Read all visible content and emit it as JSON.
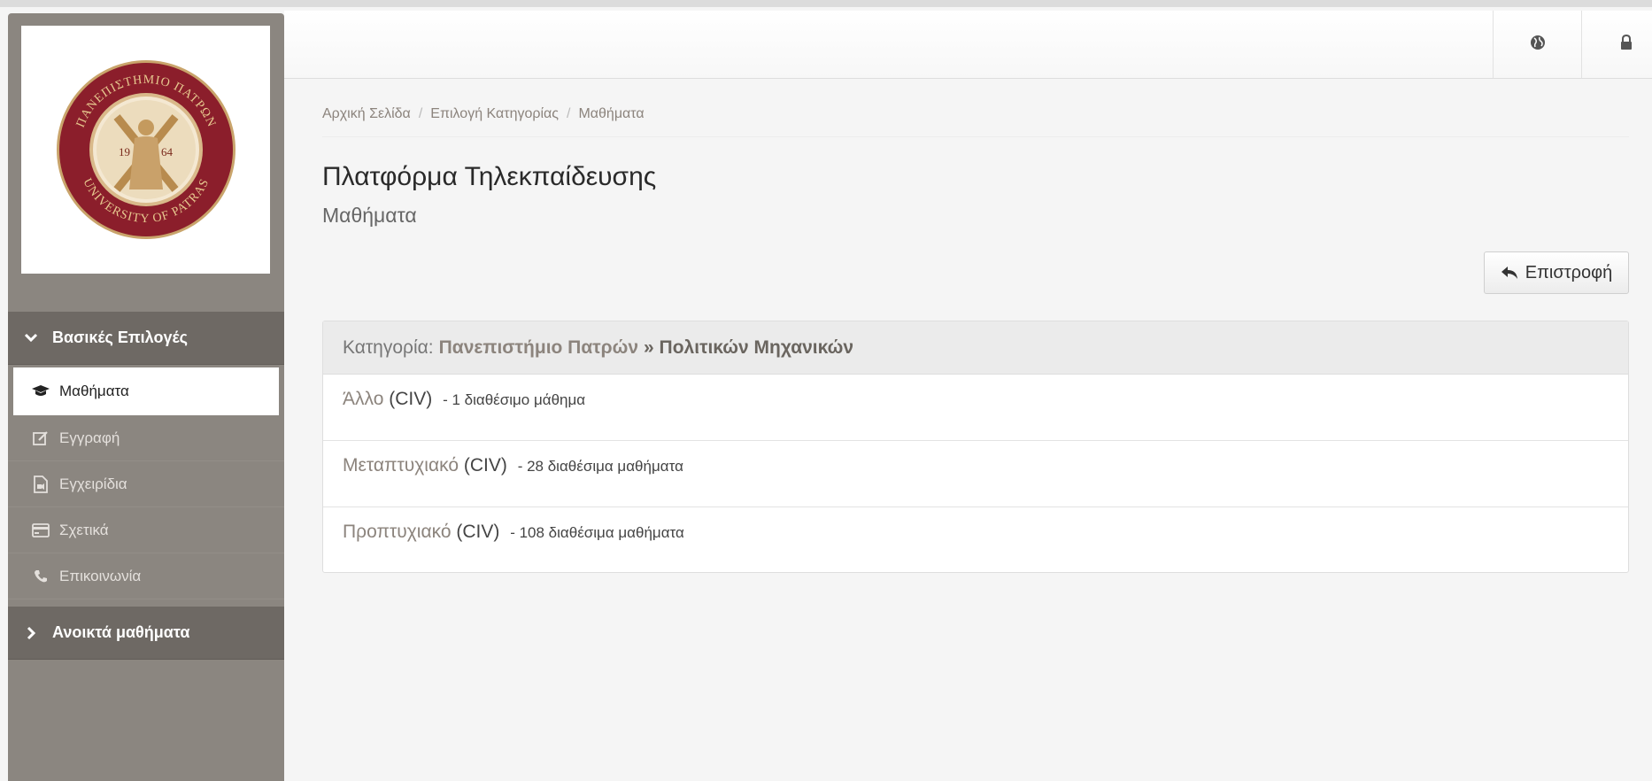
{
  "sidebar": {
    "logo": {
      "ring_top": "ΠΑΝΕΠΙΣΤΗΜΙΟ ΠΑΤΡΩΝ",
      "ring_bottom": "UNIVERSITY OF PATRAS",
      "year_left": "19",
      "year_right": "64"
    },
    "section_main": {
      "label": "Βασικές Επιλογές",
      "icon": "chevron-down-icon"
    },
    "items": [
      {
        "label": "Μαθήματα",
        "icon": "graduation-cap-icon",
        "active": true
      },
      {
        "label": "Εγγραφή",
        "icon": "edit-icon"
      },
      {
        "label": "Εγχειρίδια",
        "icon": "file-video-icon"
      },
      {
        "label": "Σχετικά",
        "icon": "credit-card-icon"
      },
      {
        "label": "Επικοινωνία",
        "icon": "phone-icon"
      }
    ],
    "section_open": {
      "label": "Ανοικτά μαθήματα",
      "icon": "chevron-right-icon"
    }
  },
  "header": {
    "buttons": [
      {
        "icon": "globe-icon"
      },
      {
        "icon": "lock-icon"
      }
    ]
  },
  "breadcrumb": {
    "items": [
      "Αρχική Σελίδα",
      "Επιλογή Κατηγορίας",
      "Μαθήματα"
    ],
    "separator": "/"
  },
  "page": {
    "title": "Πλατφόρμα Τηλεκπαίδευσης",
    "subtitle": "Μαθήματα",
    "back_label": "Επιστροφή"
  },
  "panel": {
    "heading_prefix": "Κατηγορία:",
    "heading_link": "Πανεπιστήμιο Πατρών",
    "heading_rest": "» Πολιτικών Μηχανικών",
    "rows": [
      {
        "name": "Άλλο",
        "code": "(CIV)",
        "count": "-  1 διαθέσιμο μάθημα"
      },
      {
        "name": "Μεταπτυχιακό",
        "code": "(CIV)",
        "count": "-  28 διαθέσιμα μαθήματα"
      },
      {
        "name": "Προπτυχιακό",
        "code": "(CIV)",
        "count": "-  108 διαθέσιμα μαθήματα"
      }
    ]
  },
  "colors": {
    "sidebar_bg": "#8b8680",
    "sidebar_section": "#6e6964",
    "accent_link": "#8c847d",
    "seal_red": "#8b1e2b",
    "seal_gold": "#c9a46b"
  }
}
